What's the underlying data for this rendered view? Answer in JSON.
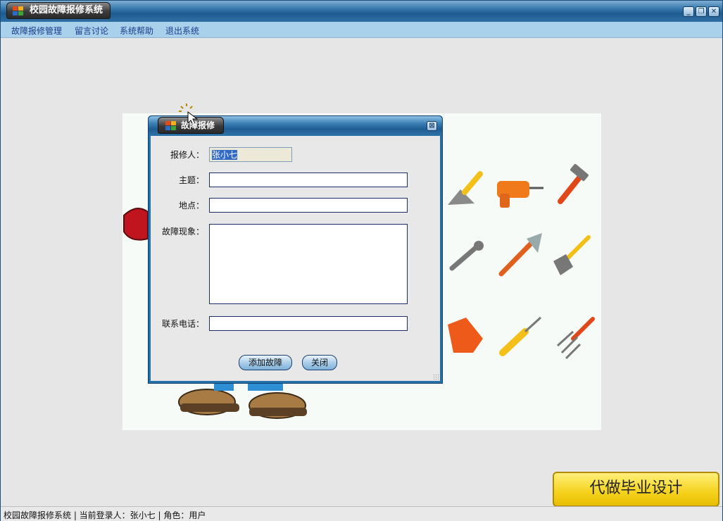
{
  "window": {
    "title": "校园故障报修系统",
    "controls": [
      "minimize-icon",
      "restore-icon",
      "close-icon"
    ]
  },
  "menu": {
    "items": [
      "故障报修管理",
      "留言讨论",
      "系统帮助",
      "退出系统"
    ]
  },
  "status_bar": {
    "text": "校园故障报修系统  |  当前登录人：张小七  |  角色：用户"
  },
  "ad": {
    "text": "代做毕业设计"
  },
  "dialog": {
    "title": "故障报修",
    "fields": {
      "reporter_label": "报修人：",
      "reporter_value": "张小七",
      "subject_label": "主题：",
      "subject_value": "",
      "location_label": "地点：",
      "location_value": "",
      "symptom_label": "故障现象：",
      "symptom_value": "",
      "phone_label": "联系电话：",
      "phone_value": ""
    },
    "buttons": {
      "add": "添加故障",
      "close": "关闭"
    }
  },
  "colors": {
    "titlebar": "#2b6ca2",
    "menubar": "#a9d1ec",
    "client_bg": "#e6e6e6",
    "ad_bg": "#f5d21c"
  }
}
